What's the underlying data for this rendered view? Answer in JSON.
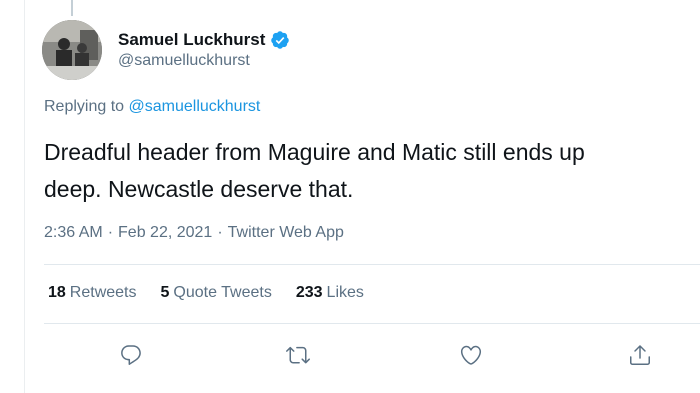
{
  "tweet": {
    "display_name": "Samuel Luckhurst",
    "handle": "@samuelluckhurst",
    "replying_prefix": "Replying to ",
    "replying_to": "@samuelluckhurst",
    "text_line1": "Dreadful header from Maguire and Matic still ends up",
    "text_line2": "deep. Newcastle deserve that.",
    "time": "2:36 AM",
    "date": "Feb 22, 2021",
    "source": "Twitter Web App",
    "separator": "·"
  },
  "stats": {
    "retweets_count": "18",
    "retweets_label": "Retweets",
    "quotes_count": "5",
    "quotes_label": "Quote Tweets",
    "likes_count": "233",
    "likes_label": "Likes"
  },
  "icons": {
    "reply": "reply-icon",
    "retweet": "retweet-icon",
    "like": "like-icon",
    "share": "share-icon",
    "verified": "verified-badge-icon"
  },
  "colors": {
    "link": "#1b95e0",
    "secondary_text": "#5b7083",
    "verified": "#1da1f2"
  }
}
